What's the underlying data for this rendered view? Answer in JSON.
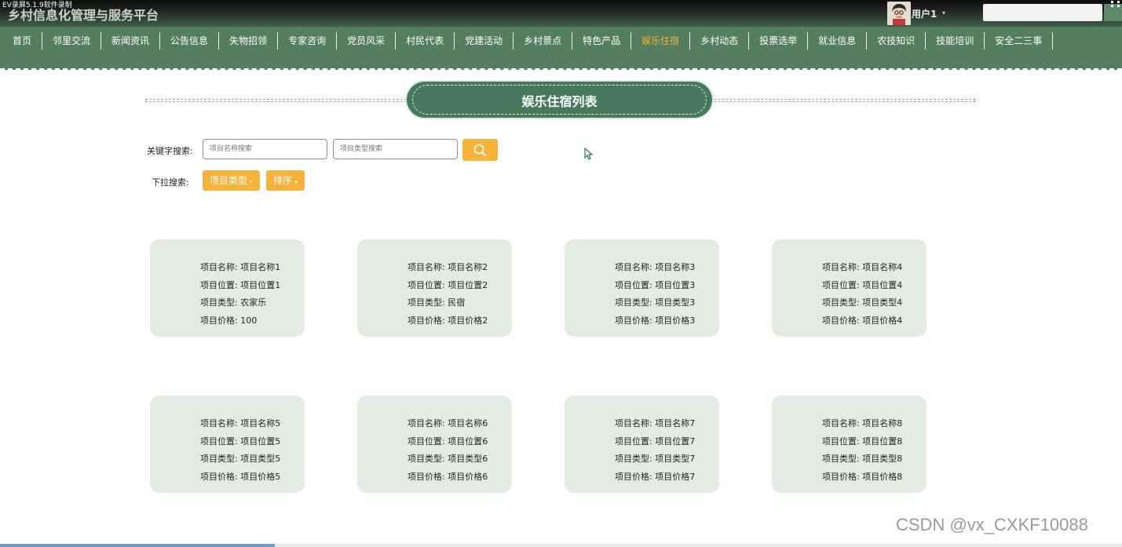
{
  "recorder_label": "EV录屏5.1.9软件录制",
  "site": {
    "title": "乡村信息化管理与服务平台"
  },
  "user": {
    "name": "用户1",
    "caret": "▾"
  },
  "nav": {
    "items": [
      "首页",
      "邻里交流",
      "新闻资讯",
      "公告信息",
      "失物招领",
      "专家咨询",
      "党员风采",
      "村民代表",
      "党建活动",
      "乡村景点",
      "特色产品",
      "娱乐住宿",
      "乡村动态",
      "投票选举",
      "就业信息",
      "农技知识",
      "技能培训",
      "安全二三事"
    ],
    "active": "娱乐住宿"
  },
  "page": {
    "title": "娱乐住宿列表"
  },
  "search": {
    "keyword_label": "关键字搜索:",
    "name_placeholder": "项目名称搜索",
    "type_placeholder": "项目类型搜索",
    "dropdown_label": "下拉搜索:",
    "type_button": "项目类型",
    "sort_button": "排序",
    "caret": "▾"
  },
  "cards": [
    {
      "name": "项目名称: 项目名称1",
      "location": "项目位置: 项目位置1",
      "type": "项目类型: 农家乐",
      "price": "项目价格: 100"
    },
    {
      "name": "项目名称: 项目名称2",
      "location": "项目位置: 项目位置2",
      "type": "项目类型: 民宿",
      "price": "项目价格: 项目价格2"
    },
    {
      "name": "项目名称: 项目名称3",
      "location": "项目位置: 项目位置3",
      "type": "项目类型: 项目类型3",
      "price": "项目价格: 项目价格3"
    },
    {
      "name": "项目名称: 项目名称4",
      "location": "项目位置: 项目位置4",
      "type": "项目类型: 项目类型4",
      "price": "项目价格: 项目价格4"
    },
    {
      "name": "项目名称: 项目名称5",
      "location": "项目位置: 项目位置5",
      "type": "项目类型: 项目类型5",
      "price": "项目价格: 项目价格5"
    },
    {
      "name": "项目名称: 项目名称6",
      "location": "项目位置: 项目位置6",
      "type": "项目类型: 项目类型6",
      "price": "项目价格: 项目价格6"
    },
    {
      "name": "项目名称: 项目名称7",
      "location": "项目位置: 项目位置7",
      "type": "项目类型: 项目类型7",
      "price": "项目价格: 项目价格7"
    },
    {
      "name": "项目名称: 项目名称8",
      "location": "项目位置: 项目位置8",
      "type": "项目类型: 项目类型8",
      "price": "项目价格: 项目价格8"
    }
  ],
  "watermark": "CSDN @vx_CXKF10088",
  "playback_progress": 0.245,
  "colors": {
    "nav_bg": "#557d5f",
    "accent": "#f6b33a",
    "banner": "#477a5c",
    "card_bg": "#e3ece3"
  },
  "icons": {
    "search": "search-icon",
    "corner": "fullscreen-icon"
  }
}
